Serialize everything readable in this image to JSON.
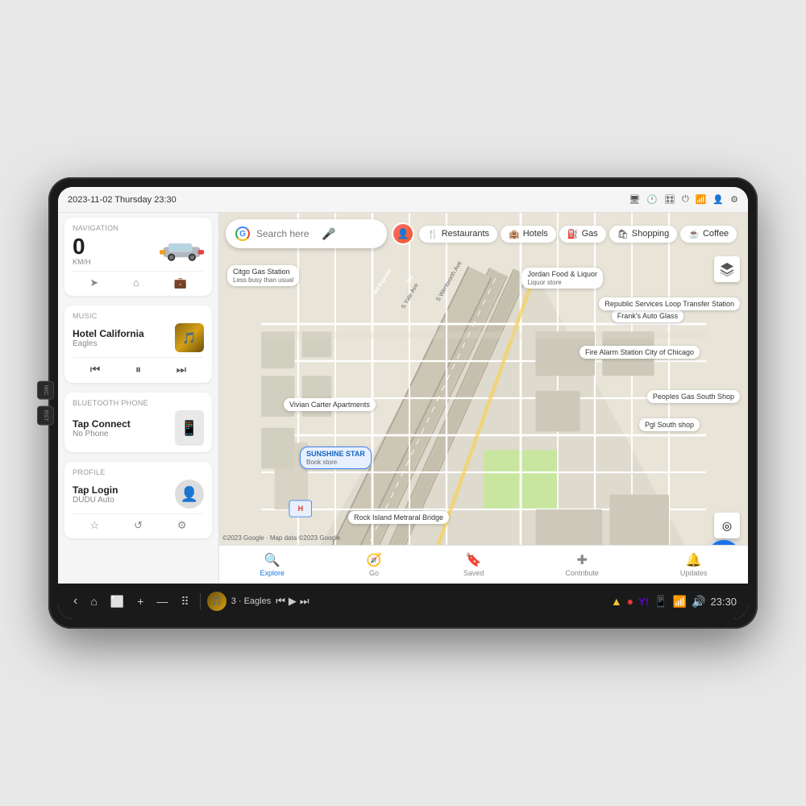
{
  "device": {
    "side_buttons": [
      "MIC",
      "RST"
    ]
  },
  "status_bar": {
    "datetime": "2023-11-02 Thursday 23:30",
    "icons": [
      "monitor-icon",
      "timer-icon",
      "car-circle-icon",
      "power-icon",
      "wifi-icon",
      "user-icon",
      "settings-icon"
    ]
  },
  "sidebar": {
    "navigation": {
      "label": "Navigation",
      "speed": "0",
      "unit": "KM/H",
      "actions": [
        "navigate-icon",
        "home-icon",
        "work-icon"
      ]
    },
    "music": {
      "label": "Music",
      "title": "Hotel California",
      "artist": "Eagles",
      "controls": [
        "prev-icon",
        "pause-icon",
        "next-icon"
      ]
    },
    "bluetooth": {
      "label": "Bluetooth Phone",
      "title": "Tap Connect",
      "subtitle": "No Phone"
    },
    "profile": {
      "label": "Profile",
      "name": "Tap Login",
      "subtitle": "DUDU Auto",
      "actions": [
        "star-icon",
        "refresh-icon",
        "settings-icon"
      ]
    }
  },
  "map": {
    "search_placeholder": "Search here",
    "filters": [
      "Restaurants",
      "Hotels",
      "Gas",
      "Shopping",
      "Coffee"
    ],
    "places": [
      {
        "name": "Citgo Gas Station",
        "sub": "Less busy than usual"
      },
      {
        "name": "Jordan Food & Liquor",
        "sub": "Liquor store"
      },
      {
        "name": "Frank's Auto Glass"
      },
      {
        "name": "Fire Alarm Station City of Chicago"
      },
      {
        "name": "Republic Services Loop Transfer Station"
      },
      {
        "name": "Peoples Gas South Shop"
      },
      {
        "name": "Pgl South shop"
      },
      {
        "name": "Vivian Carter Apartments"
      },
      {
        "name": "SUNSHINE STAR",
        "sub": "Book store"
      },
      {
        "name": "Rock Island Metraral Bridge"
      }
    ],
    "copyright": "©2023 Google · Map data ©2023 Google",
    "bottom_nav": [
      {
        "icon": "explore-icon",
        "label": "Explore",
        "active": true
      },
      {
        "icon": "go-icon",
        "label": "Go",
        "active": false
      },
      {
        "icon": "saved-icon",
        "label": "Saved",
        "active": false
      },
      {
        "icon": "contribute-icon",
        "label": "Contribute",
        "active": false
      },
      {
        "icon": "updates-icon",
        "label": "Updates",
        "active": false
      }
    ]
  },
  "system_bar": {
    "back_label": "‹",
    "home_label": "⌂",
    "apps_label": "⬜",
    "add_label": "+",
    "minus_label": "—",
    "grid_label": "⠿",
    "now_playing": "3 · Eagles",
    "nav_indicator": "▶",
    "skip_label": "⏭",
    "gps_icon": "gps-icon",
    "record_icon": "record-icon",
    "yahoo_icon": "yahoo-icon",
    "apps2_icon": "apps2-icon",
    "wifi_sys": "wifi-sys-icon",
    "volume_icon": "volume-icon",
    "clock": "23:30"
  }
}
